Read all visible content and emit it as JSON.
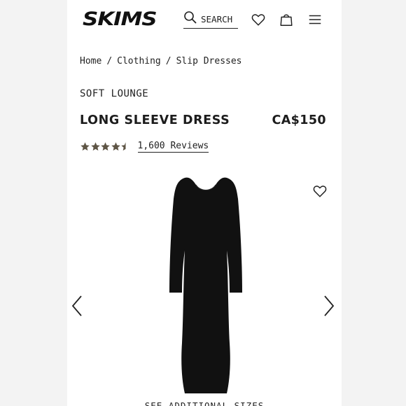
{
  "header": {
    "logo": "SKIMS",
    "search_label": "SEARCH",
    "icons": [
      "search-icon",
      "heart-icon",
      "shopping-bag-icon",
      "menu-icon"
    ]
  },
  "breadcrumb": {
    "items": [
      "Home",
      "Clothing",
      "Slip Dresses"
    ],
    "separator": "/"
  },
  "product": {
    "collection": "SOFT LOUNGE",
    "name": "LONG SLEEVE DRESS",
    "price": "CA$150",
    "rating": 4.5,
    "rating_max": 5,
    "reviews_label": "1,600 Reviews"
  },
  "gallery": {
    "see_sizes_label": "SEE ADDITIONAL SIZES",
    "icons": [
      "wishlist-heart-icon",
      "chevron-left-icon",
      "chevron-right-icon"
    ]
  },
  "colors": {
    "star": "#5e5545",
    "dress": "#111111",
    "background": "#ffffff",
    "gutter": "#f3f3f3"
  }
}
